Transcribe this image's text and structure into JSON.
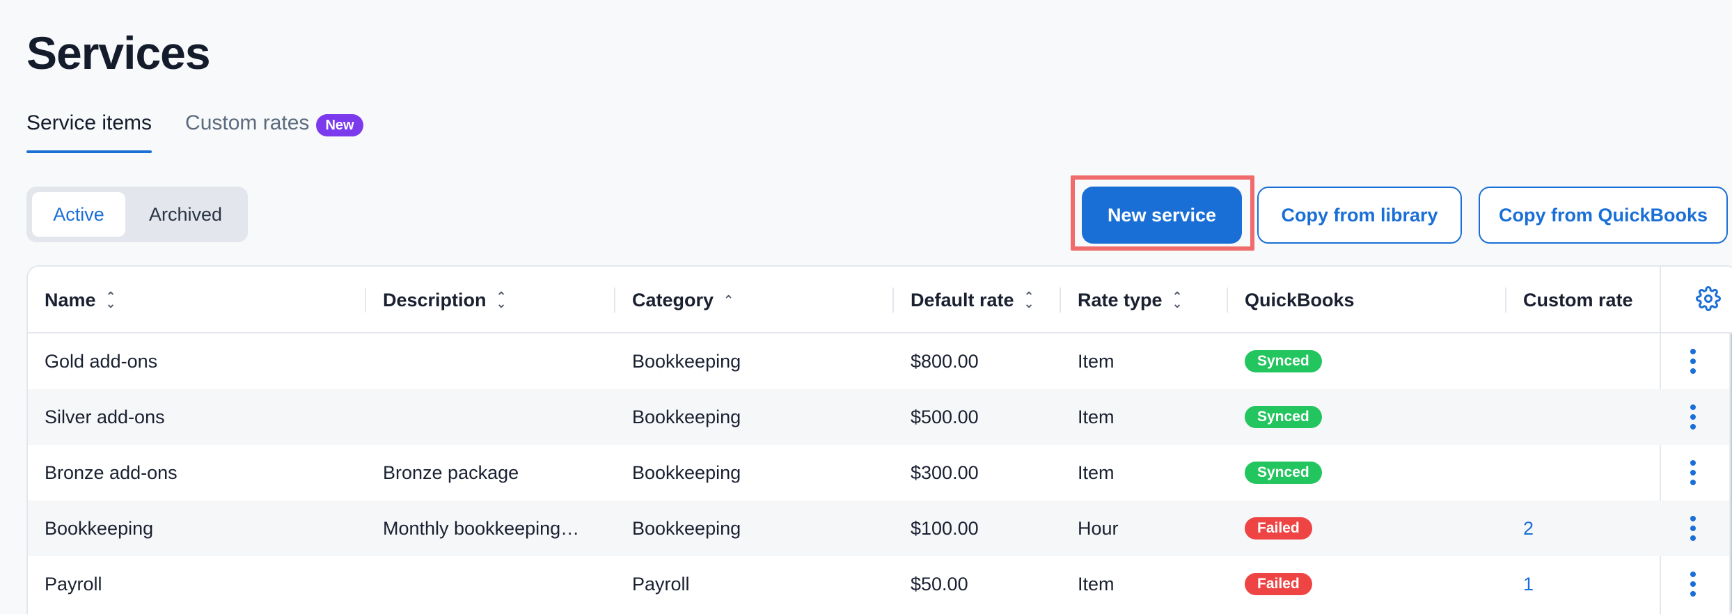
{
  "page": {
    "title": "Services"
  },
  "tabs": [
    {
      "label": "Service items",
      "active": true
    },
    {
      "label": "Custom rates",
      "badge": "New",
      "active": false
    }
  ],
  "filter": {
    "options": [
      "Active",
      "Archived"
    ],
    "selected": "Active"
  },
  "actions": {
    "new_service": "New service",
    "copy_library": "Copy from library",
    "copy_quickbooks": "Copy from QuickBooks"
  },
  "table": {
    "columns": [
      "Name",
      "Description",
      "Category",
      "Default rate",
      "Rate type",
      "QuickBooks",
      "Custom rate"
    ],
    "rows": [
      {
        "name": "Gold add-ons",
        "description": "",
        "category": "Bookkeeping",
        "rate": "$800.00",
        "rate_type": "Item",
        "quickbooks": "Synced",
        "custom_rate": ""
      },
      {
        "name": "Silver add-ons",
        "description": "",
        "category": "Bookkeeping",
        "rate": "$500.00",
        "rate_type": "Item",
        "quickbooks": "Synced",
        "custom_rate": ""
      },
      {
        "name": "Bronze add-ons",
        "description": "Bronze package",
        "category": "Bookkeeping",
        "rate": "$300.00",
        "rate_type": "Item",
        "quickbooks": "Synced",
        "custom_rate": ""
      },
      {
        "name": "Bookkeeping",
        "description": "Monthly bookkeeping…",
        "category": "Bookkeeping",
        "rate": "$100.00",
        "rate_type": "Hour",
        "quickbooks": "Failed",
        "custom_rate": "2"
      },
      {
        "name": "Payroll",
        "description": "",
        "category": "Payroll",
        "rate": "$50.00",
        "rate_type": "Item",
        "quickbooks": "Failed",
        "custom_rate": "1"
      }
    ]
  },
  "colors": {
    "accent": "#1a6fd6",
    "synced": "#22c55e",
    "failed": "#ef4444",
    "badge": "#7c3aed",
    "highlight": "#f06b6b"
  },
  "icons": {
    "settings": "gear-icon",
    "row_menu": "more-vertical-icon",
    "sort": "sort-icon",
    "sort_asc": "sort-ascending-icon"
  }
}
